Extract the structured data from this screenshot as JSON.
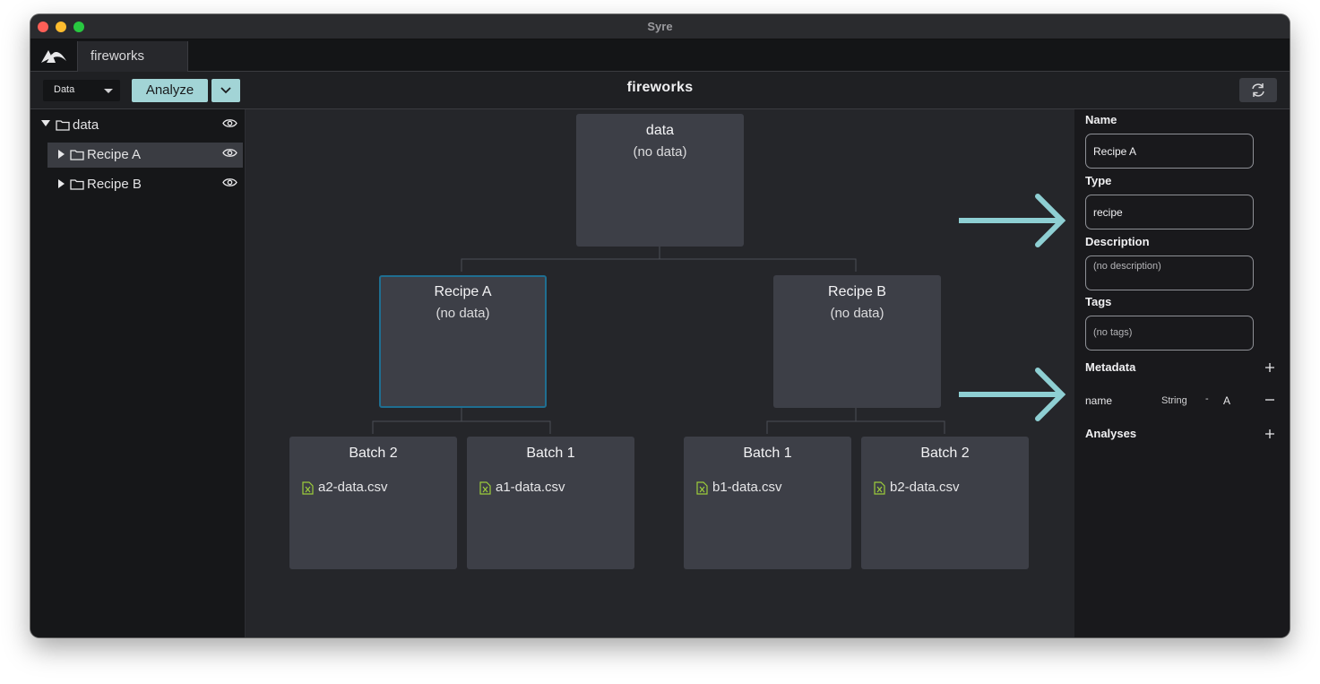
{
  "window": {
    "title": "Syre"
  },
  "tabs": [
    {
      "label": "fireworks"
    }
  ],
  "toolbar": {
    "view_select": "Data",
    "analyze_label": "Analyze",
    "project_title": "fireworks"
  },
  "tree": {
    "root": {
      "label": "data"
    },
    "items": [
      {
        "label": "Recipe A",
        "selected": true
      },
      {
        "label": "Recipe B",
        "selected": false
      }
    ]
  },
  "graph": {
    "root": {
      "title": "data",
      "subtitle": "(no data)"
    },
    "containers": [
      {
        "title": "Recipe A",
        "subtitle": "(no data)"
      },
      {
        "title": "Recipe B",
        "subtitle": "(no data)"
      }
    ],
    "batches": [
      {
        "title": "Batch 2",
        "asset": "a2-data.csv"
      },
      {
        "title": "Batch 1",
        "asset": "a1-data.csv"
      },
      {
        "title": "Batch 1",
        "asset": "b1-data.csv"
      },
      {
        "title": "Batch 2",
        "asset": "b2-data.csv"
      }
    ]
  },
  "properties": {
    "name_label": "Name",
    "name_value": "Recipe A",
    "type_label": "Type",
    "type_value": "recipe",
    "description_label": "Description",
    "description_placeholder": "(no description)",
    "tags_label": "Tags",
    "tags_placeholder": "(no tags)",
    "metadata_label": "Metadata",
    "metadata": [
      {
        "key": "name",
        "type": "String",
        "separator": "-",
        "value": "A"
      }
    ],
    "analyses_label": "Analyses"
  },
  "colors": {
    "accent": "#a2d4d6",
    "annotation_arrow": "#8ecfd3",
    "selected_border": "#1f6e91",
    "node_bg": "#3d3f47",
    "csv_icon": "#9ccc3b"
  }
}
